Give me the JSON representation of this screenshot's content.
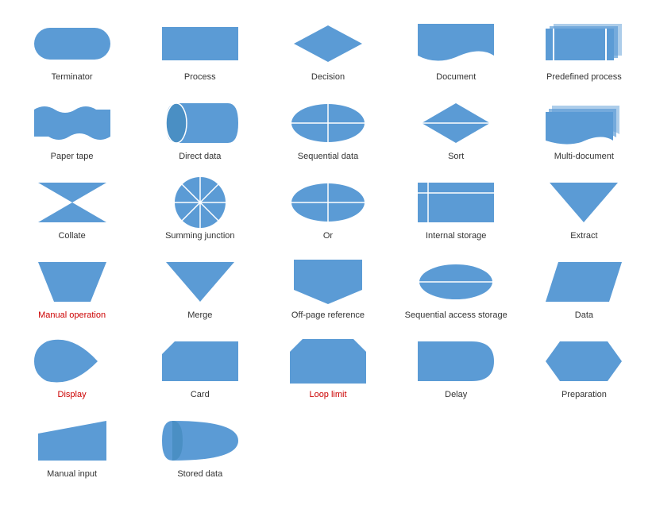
{
  "shapes": [
    {
      "id": "terminator",
      "label": "Terminator",
      "red": false
    },
    {
      "id": "process",
      "label": "Process",
      "red": false
    },
    {
      "id": "decision",
      "label": "Decision",
      "red": false
    },
    {
      "id": "document",
      "label": "Document",
      "red": false
    },
    {
      "id": "predefined-process",
      "label": "Predefined process",
      "red": false
    },
    {
      "id": "paper-tape",
      "label": "Paper tape",
      "red": false
    },
    {
      "id": "direct-data",
      "label": "Direct data",
      "red": false
    },
    {
      "id": "sequential-data",
      "label": "Sequential data",
      "red": false
    },
    {
      "id": "sort",
      "label": "Sort",
      "red": false
    },
    {
      "id": "multi-document",
      "label": "Multi-document",
      "red": false
    },
    {
      "id": "collate",
      "label": "Collate",
      "red": false
    },
    {
      "id": "summing-junction",
      "label": "Summing junction",
      "red": false
    },
    {
      "id": "or",
      "label": "Or",
      "red": false
    },
    {
      "id": "internal-storage",
      "label": "Internal storage",
      "red": false
    },
    {
      "id": "extract",
      "label": "Extract",
      "red": false
    },
    {
      "id": "manual-operation",
      "label": "Manual operation",
      "red": true
    },
    {
      "id": "merge",
      "label": "Merge",
      "red": false
    },
    {
      "id": "off-page-reference",
      "label": "Off-page reference",
      "red": false
    },
    {
      "id": "sequential-access-storage",
      "label": "Sequential access storage",
      "red": false
    },
    {
      "id": "data",
      "label": "Data",
      "red": false
    },
    {
      "id": "display",
      "label": "Display",
      "red": true
    },
    {
      "id": "card",
      "label": "Card",
      "red": false
    },
    {
      "id": "loop-limit",
      "label": "Loop limit",
      "red": true
    },
    {
      "id": "delay",
      "label": "Delay",
      "red": false
    },
    {
      "id": "preparation",
      "label": "Preparation",
      "red": false
    },
    {
      "id": "manual-input",
      "label": "Manual input",
      "red": false
    },
    {
      "id": "stored-data",
      "label": "Stored data",
      "red": false
    }
  ]
}
